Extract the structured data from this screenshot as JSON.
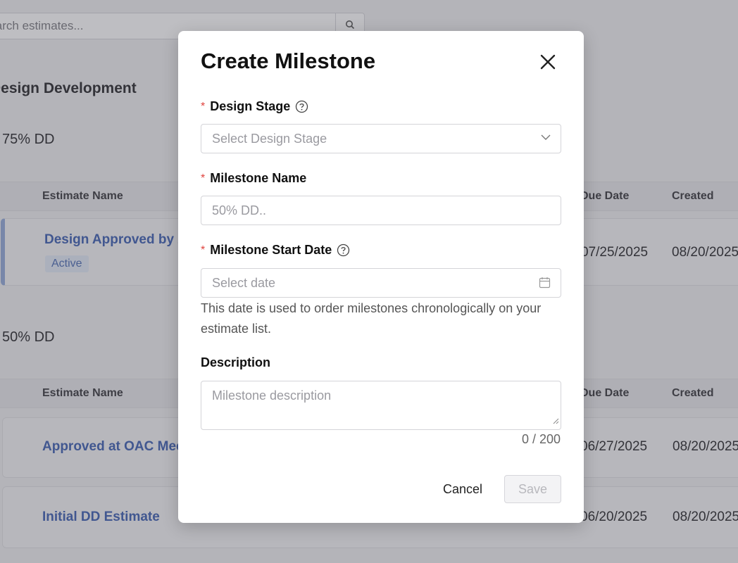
{
  "background": {
    "search": {
      "placeholder": "Search estimates..."
    },
    "section_title": "Design Development",
    "groups": [
      {
        "label": "75% DD",
        "headers": {
          "estimate_name": "Estimate Name",
          "due_date": "Due Date",
          "created": "Created"
        },
        "rows": [
          {
            "name": "Design Approved by Z",
            "badge": "Active",
            "due_date": "07/25/2025",
            "created": "08/20/2025"
          }
        ]
      },
      {
        "label": "50% DD",
        "headers": {
          "estimate_name": "Estimate Name",
          "due_date": "Due Date",
          "created": "Created"
        },
        "rows": [
          {
            "name": "Approved at OAC Mee",
            "due_date": "06/27/2025",
            "created": "08/20/2025"
          },
          {
            "name": "Initial DD Estimate",
            "due_date": "06/20/2025",
            "created": "08/20/2025"
          }
        ]
      }
    ]
  },
  "modal": {
    "title": "Create Milestone",
    "fields": {
      "design_stage": {
        "label": "Design Stage",
        "required_mark": "*",
        "placeholder": "Select Design Stage"
      },
      "milestone_name": {
        "label": "Milestone Name",
        "required_mark": "*",
        "placeholder": "50% DD.."
      },
      "start_date": {
        "label": "Milestone Start Date",
        "required_mark": "*",
        "placeholder": "Select date",
        "hint": "This date is used to order milestones chronologically on your estimate list."
      },
      "description": {
        "label": "Description",
        "placeholder": "Milestone description",
        "counter": "0 / 200"
      }
    },
    "cancel_label": "Cancel",
    "save_label": "Save"
  },
  "colors": {
    "required": "#e0443e",
    "link": "#3e5fae",
    "overlay": "rgba(70,70,80,0.32)"
  },
  "icons": [
    "search-icon",
    "close-icon",
    "help-icon",
    "chevron-down-icon",
    "calendar-icon",
    "resize-grip-icon"
  ]
}
